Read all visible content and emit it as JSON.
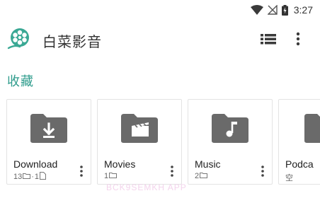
{
  "status_bar": {
    "time": "3:27",
    "icons": [
      "wifi-icon",
      "no-signal-icon",
      "battery-charging-icon"
    ]
  },
  "app_bar": {
    "title": "白菜影音",
    "logo_icon": "film-reel-icon",
    "actions": [
      "list-view-icon",
      "more-vertical-icon"
    ]
  },
  "section": {
    "title": "收藏"
  },
  "folders": [
    {
      "name": "Download",
      "icon": "folder-download-icon",
      "meta_count_folders": "13",
      "meta_separator": "·",
      "meta_count_files": "1"
    },
    {
      "name": "Movies",
      "icon": "folder-movie-icon",
      "meta_count_folders": "1"
    },
    {
      "name": "Music",
      "icon": "folder-music-icon",
      "meta_count_folders": "2"
    },
    {
      "name": "Podca",
      "icon": "folder-icon",
      "meta_text": "空"
    }
  ],
  "watermark": "BCK9SEMKH APP",
  "colors": {
    "accent": "#2e9c8c",
    "folder": "#6a6a6a",
    "text_primary": "#212121",
    "text_secondary": "#666666"
  }
}
